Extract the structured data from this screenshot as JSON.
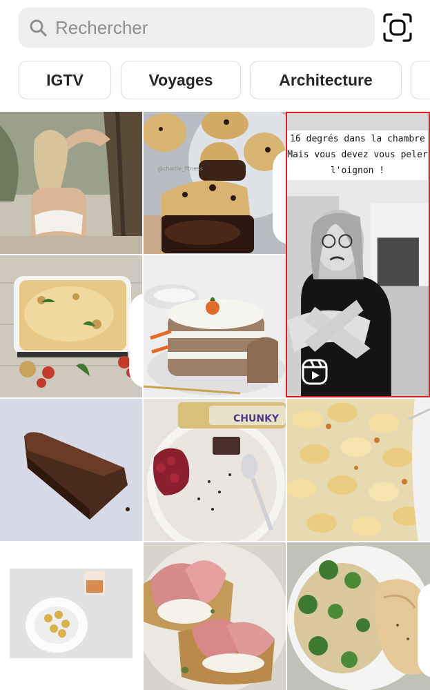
{
  "search": {
    "placeholder": "Rechercher",
    "search_icon": "search-icon",
    "scan_icon": "scan-icon"
  },
  "chips": [
    {
      "label": "IGTV"
    },
    {
      "label": "Voyages"
    },
    {
      "label": "Architecture"
    },
    {
      "label": ""
    }
  ],
  "grid": {
    "reel": {
      "caption_lines": [
        "16 degrés dans la chambre",
        "Mais vous devez vous peler",
        "l'oignon !"
      ],
      "icon": "reels-icon"
    },
    "tiles": [
      {
        "name": "photo-woman-beach"
      },
      {
        "name": "photo-cookies-watermark",
        "watermark": "@charlie_fitness",
        "multi": true
      },
      {
        "name": "photo-gratin-dish",
        "multi": true
      },
      {
        "name": "photo-carrot-cake"
      },
      {
        "name": "photo-chocolate-cake-slice"
      },
      {
        "name": "photo-porridge-bowl",
        "bar_label": "CHUNKY"
      },
      {
        "name": "photo-mac-and-cheese"
      },
      {
        "name": "photo-plate-potatoes"
      },
      {
        "name": "photo-toast-prosciutto"
      },
      {
        "name": "photo-rice-broccoli-chicken",
        "multi": true
      }
    ]
  },
  "colors": {
    "accent_border": "#e21b23",
    "search_bg": "#efefef",
    "chip_border": "#dbdbdb"
  }
}
